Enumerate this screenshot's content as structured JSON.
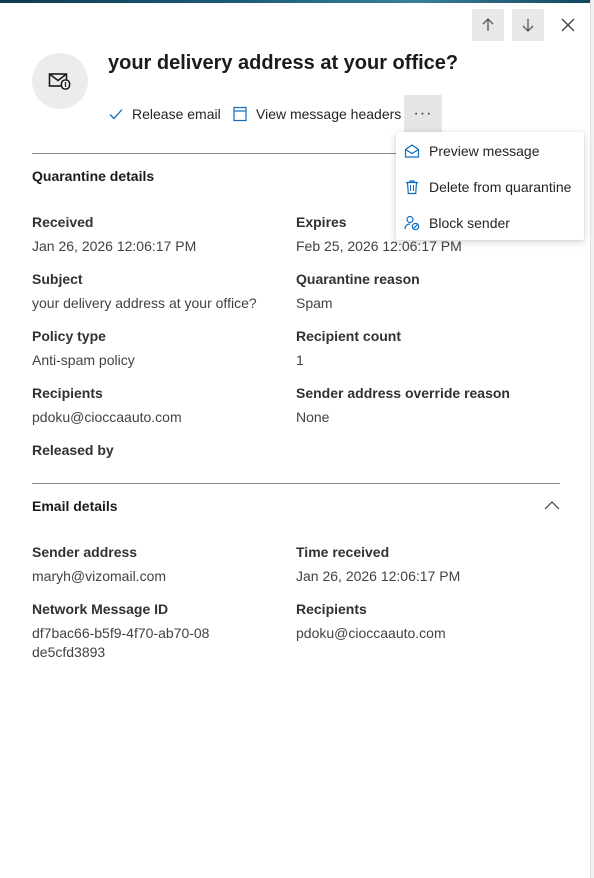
{
  "header": {
    "title": "your delivery address at your office?"
  },
  "nav": {
    "prev_icon": "arrow-up-icon",
    "next_icon": "arrow-down-icon",
    "close_icon": "close-icon"
  },
  "commands": {
    "release_label": "Release email",
    "headers_label": "View message headers",
    "more_label": "···"
  },
  "menu": {
    "items": [
      {
        "label": "Preview message",
        "icon": "envelope-open-icon"
      },
      {
        "label": "Delete from quarantine",
        "icon": "trash-icon"
      },
      {
        "label": "Block sender",
        "icon": "block-person-icon"
      }
    ]
  },
  "quarantine": {
    "title": "Quarantine details",
    "received_label": "Received",
    "received_value": "Jan 26, 2026 12:06:17 PM",
    "expires_label": "Expires",
    "expires_value": "Feb 25, 2026 12:06:17 PM",
    "subject_label": "Subject",
    "subject_value": "your delivery address at your office?",
    "reason_label": "Quarantine reason",
    "reason_value": "Spam",
    "policy_label": "Policy type",
    "policy_value": "Anti-spam policy",
    "count_label": "Recipient count",
    "count_value": "1",
    "recipients_label": "Recipients",
    "recipients_value": "pdoku@cioccaauto.com",
    "override_label": "Sender address override reason",
    "override_value": "None",
    "released_by_label": "Released by"
  },
  "email": {
    "title": "Email details",
    "sender_label": "Sender address",
    "sender_value": "maryh@vizomail.com",
    "time_label": "Time received",
    "time_value": "Jan 26, 2026 12:06:17 PM",
    "netid_label": "Network Message ID",
    "netid_value": "df7bac66-b5f9-4f70-ab70-08de5cfd3893",
    "recipients_label": "Recipients",
    "recipients_value": "pdoku@cioccaauto.com"
  },
  "colors": {
    "accent": "#0f6cbd",
    "button_bg": "#e6e6e6"
  }
}
